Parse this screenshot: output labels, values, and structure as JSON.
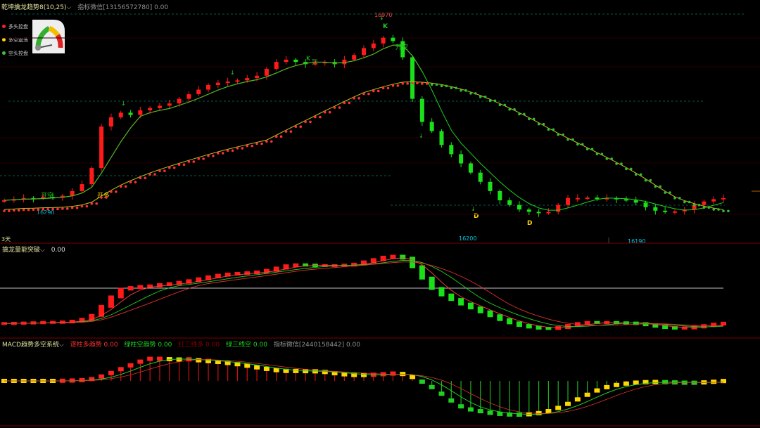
{
  "colors": {
    "bg": "#000000",
    "up": "#ff1a1a",
    "down": "#19e019",
    "yellow": "#ffd700",
    "cyan": "#00c8e6",
    "grid": "#7a0000",
    "zero": "#c0c0c0"
  },
  "main": {
    "title": "乾坤擒龙趋势8(10,25)",
    "sub": "指标微信[13156572780] 0.00",
    "legend": [
      {
        "label": "多头控盘",
        "color": "#ff2020"
      },
      {
        "label": "多空震荡",
        "color": "#ffd700"
      },
      {
        "label": "空头控盘",
        "color": "#20c020"
      }
    ],
    "annotations": {
      "high": "16970",
      "mid_low": "16200",
      "low2": "16190",
      "left_low": "16290",
      "period": "3天",
      "kai_kong_1": "开空",
      "kai_duo": "开多",
      "kai_kong_2": "开空",
      "k1": "K",
      "k2": "K",
      "ding": "顶",
      "d1": "D",
      "d2": "D"
    }
  },
  "panel2": {
    "title": "擒龙量能突破",
    "value": "0.00"
  },
  "panel3": {
    "title": "MACD趋势多空系统",
    "items": [
      {
        "text": "逐柱多趋势 0.00",
        "color": "#ff3030"
      },
      {
        "text": "绿柱空趋势 0.00",
        "color": "#20d020"
      },
      {
        "text": "红三线多 0.00",
        "color": "#8b0000"
      },
      {
        "text": "绿三线空 0.00",
        "color": "#20d020"
      },
      {
        "text": "指标微信[2440158442] 0.00",
        "color": "#909090"
      }
    ]
  },
  "chart_data": [
    {
      "type": "candlestick",
      "title": "乾坤擒龙趋势8(10,25)",
      "close_path": [
        16260,
        16265,
        16270,
        16268,
        16275,
        16272,
        16280,
        16300,
        16330,
        16400,
        16580,
        16620,
        16640,
        16630,
        16650,
        16660,
        16670,
        16680,
        16700,
        16720,
        16740,
        16760,
        16770,
        16775,
        16780,
        16790,
        16800,
        16830,
        16860,
        16870,
        16860,
        16850,
        16855,
        16860,
        16850,
        16870,
        16890,
        16920,
        16940,
        16965,
        16950,
        16880,
        16700,
        16600,
        16560,
        16500,
        16460,
        16420,
        16380,
        16340,
        16300,
        16260,
        16240,
        16220,
        16210,
        16205,
        16210,
        16240,
        16270,
        16270,
        16272,
        16268,
        16270,
        16265,
        16260,
        16250,
        16230,
        16215,
        16210,
        16212,
        16220,
        16240,
        16255,
        16265,
        16270
      ],
      "labels": {
        "high": 16970,
        "lows": [
          16290,
          16200,
          16190
        ]
      }
    },
    {
      "type": "line",
      "title": "擒龙量能突破",
      "series": [
        {
          "name": "擒龙量能突破",
          "values": [
            0.0
          ]
        }
      ]
    },
    {
      "type": "bar",
      "title": "MACD趋势多空系统",
      "series": [
        {
          "name": "逐柱多趋势",
          "values": [
            0.0
          ]
        },
        {
          "name": "绿柱空趋势",
          "values": [
            0.0
          ]
        },
        {
          "name": "红三线多",
          "values": [
            0.0
          ]
        },
        {
          "name": "绿三线空",
          "values": [
            0.0
          ]
        }
      ]
    }
  ]
}
